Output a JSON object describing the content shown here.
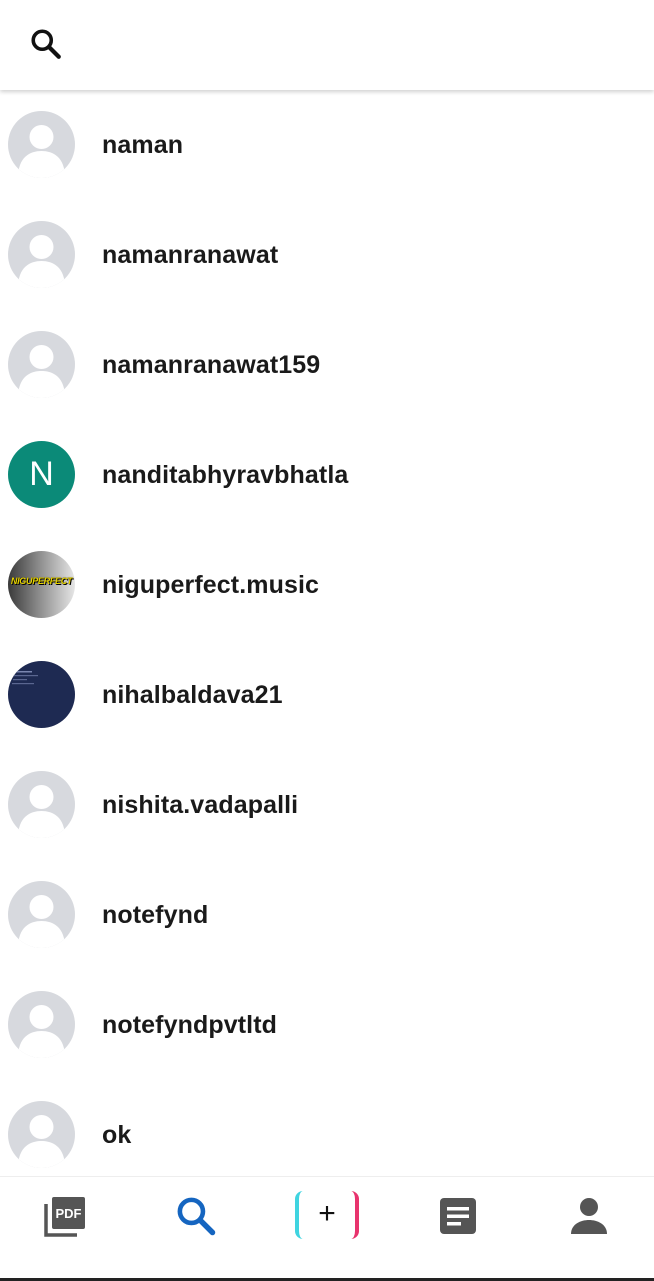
{
  "header": {
    "search_icon": "search-icon"
  },
  "users": [
    {
      "username": "naman",
      "avatar": "default"
    },
    {
      "username": "namanranawat",
      "avatar": "default"
    },
    {
      "username": "namanranawat159",
      "avatar": "default"
    },
    {
      "username": "nanditabhyravbhatla",
      "avatar": "letter",
      "initial": "N"
    },
    {
      "username": "niguperfect.music",
      "avatar": "image",
      "image_text": "NIGUPERFECT"
    },
    {
      "username": "nihalbaldava21",
      "avatar": "image"
    },
    {
      "username": "nishita.vadapalli",
      "avatar": "default"
    },
    {
      "username": "notefynd",
      "avatar": "default"
    },
    {
      "username": "notefyndpvtltd",
      "avatar": "default"
    },
    {
      "username": "ok",
      "avatar": "default"
    }
  ],
  "bottom_nav": {
    "items": [
      {
        "name": "pdf",
        "icon": "pdf-icon",
        "label": "PDF"
      },
      {
        "name": "search",
        "icon": "search-icon",
        "active": true
      },
      {
        "name": "add",
        "icon": "plus-icon",
        "symbol": "+"
      },
      {
        "name": "notes",
        "icon": "document-icon"
      },
      {
        "name": "profile",
        "icon": "person-icon"
      }
    ]
  },
  "colors": {
    "active_blue": "#1565c0",
    "inactive_gray": "#555555",
    "avatar_teal": "#0b8a78",
    "add_left": "#3fd4e0",
    "add_right": "#e8336d"
  }
}
